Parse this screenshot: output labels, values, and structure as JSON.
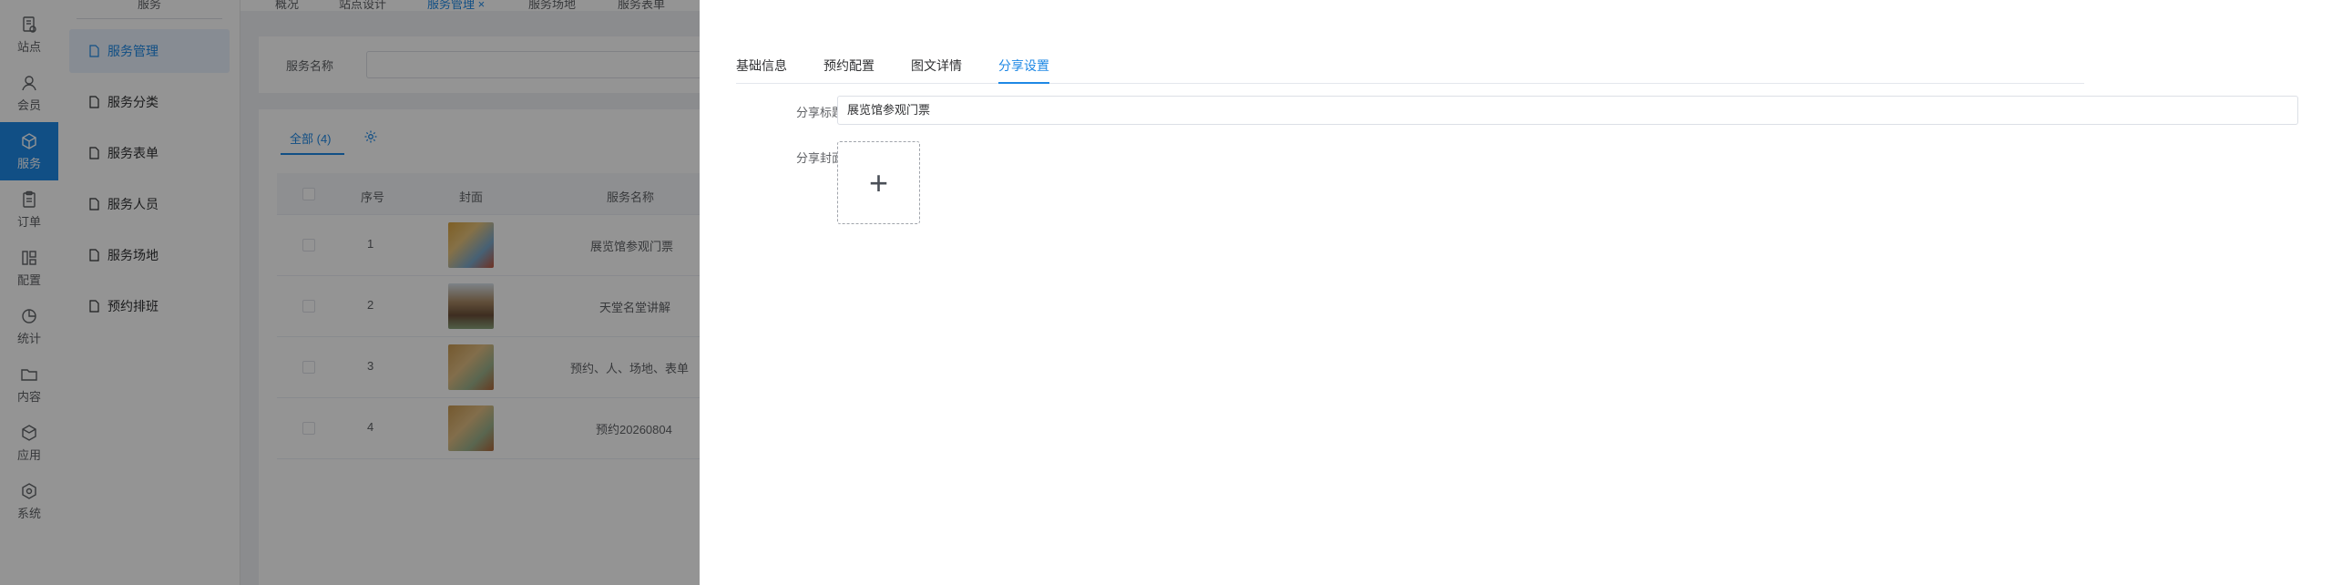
{
  "rail": {
    "items": [
      {
        "label": "站点",
        "icon": "site-icon"
      },
      {
        "label": "会员",
        "icon": "user-icon"
      },
      {
        "label": "服务",
        "icon": "cube-icon"
      },
      {
        "label": "订单",
        "icon": "clipboard-icon"
      },
      {
        "label": "配置",
        "icon": "layout-icon"
      },
      {
        "label": "统计",
        "icon": "pie-icon"
      },
      {
        "label": "内容",
        "icon": "folder-icon"
      },
      {
        "label": "应用",
        "icon": "box-icon"
      },
      {
        "label": "系统",
        "icon": "hexagon-icon"
      }
    ],
    "active": 2,
    "accent": "#1e88e5"
  },
  "subnav": {
    "header": "服务",
    "items": [
      "服务管理",
      "服务分类",
      "服务表单",
      "服务人员",
      "服务场地",
      "预约排班"
    ],
    "active": 0
  },
  "tabbar": {
    "tabs": [
      "概况",
      "站点设计",
      "服务管理 ×",
      "服务场地",
      "服务表单"
    ],
    "active": 2
  },
  "search": {
    "label": "服务名称",
    "value": ""
  },
  "list": {
    "tab_label": "全部 (4)",
    "columns": [
      "序号",
      "封面",
      "服务名称"
    ],
    "rows": [
      {
        "index": "1",
        "name": "展览馆参观门票"
      },
      {
        "index": "2",
        "name": "天堂名堂讲解"
      },
      {
        "index": "3",
        "name": "预约、人、场地、表单"
      },
      {
        "index": "4",
        "name": "预约20260804"
      }
    ]
  },
  "drawer": {
    "tabs": [
      "基础信息",
      "预约配置",
      "图文详情",
      "分享设置"
    ],
    "active_tab": 3,
    "share_title_label": "分享标题",
    "share_title_value": "展览馆参观门票",
    "share_cover_label": "分享封面",
    "upload_symbol": "+"
  }
}
